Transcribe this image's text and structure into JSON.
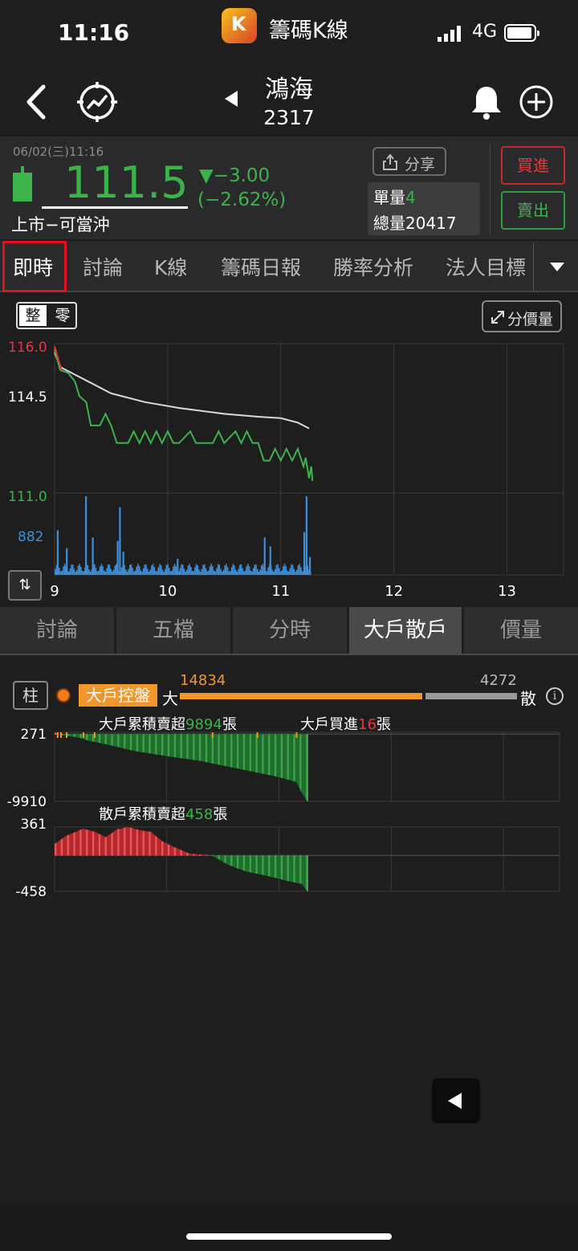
{
  "status_bar": {
    "time": "11:16",
    "app_name": "籌碼K線",
    "app_icon_letter": "K",
    "network": "4G"
  },
  "stock": {
    "name": "鴻海",
    "code": "2317"
  },
  "quote": {
    "datetime": "06/02(三)11:16",
    "price": "111.5",
    "change": "▼−3.00",
    "change_pct": "(−2.62%)",
    "market": "上市−可當沖",
    "share_label": "分享",
    "unit_vol_label": "單量",
    "unit_vol": "4",
    "total_vol_label": "總量",
    "total_vol": "20417",
    "buy_label": "買進",
    "sell_label": "賣出"
  },
  "tabs": [
    "即時",
    "討論",
    "K線",
    "籌碼日報",
    "勝率分析",
    "法人目標"
  ],
  "chart_controls": {
    "whole_label": "整",
    "odd_label": "零",
    "price_volume_label": "分價量"
  },
  "chart_data": [
    {
      "type": "line",
      "y_axis_labels": [
        "116.0",
        "114.5",
        "111.0"
      ],
      "volume_label": "882",
      "x": [
        "9",
        "10",
        "11",
        "12",
        "13"
      ],
      "ylim": [
        111.0,
        116.0
      ],
      "xlim": [
        9,
        13.5
      ],
      "series": [
        {
          "color": "#d9d9d9",
          "points": [
            [
              9.0,
              115.7
            ],
            [
              9.05,
              115.2
            ],
            [
              9.15,
              115.0
            ],
            [
              9.3,
              114.7
            ],
            [
              9.5,
              114.3
            ],
            [
              9.8,
              114.0
            ],
            [
              10.1,
              113.8
            ],
            [
              10.5,
              113.6
            ],
            [
              10.8,
              113.5
            ],
            [
              11.0,
              113.45
            ],
            [
              11.15,
              113.3
            ],
            [
              11.25,
              113.1
            ]
          ]
        },
        {
          "color": "#3cb34a",
          "points": [
            [
              9.0,
              115.8
            ],
            [
              9.05,
              115.1
            ],
            [
              9.12,
              115.0
            ],
            [
              9.18,
              114.7
            ],
            [
              9.22,
              114.2
            ],
            [
              9.28,
              114.0
            ],
            [
              9.32,
              113.2
            ],
            [
              9.4,
              113.2
            ],
            [
              9.45,
              113.6
            ],
            [
              9.5,
              113.2
            ],
            [
              9.55,
              112.6
            ],
            [
              9.65,
              112.6
            ],
            [
              9.7,
              113.0
            ],
            [
              9.75,
              112.6
            ],
            [
              9.8,
              113.0
            ],
            [
              9.85,
              112.6
            ],
            [
              9.9,
              113.0
            ],
            [
              9.95,
              112.6
            ],
            [
              10.0,
              113.0
            ],
            [
              10.05,
              112.6
            ],
            [
              10.1,
              112.6
            ],
            [
              10.2,
              113.0
            ],
            [
              10.25,
              112.6
            ],
            [
              10.4,
              112.6
            ],
            [
              10.45,
              113.0
            ],
            [
              10.5,
              112.6
            ],
            [
              10.6,
              113.0
            ],
            [
              10.65,
              112.6
            ],
            [
              10.7,
              113.0
            ],
            [
              10.75,
              112.6
            ],
            [
              10.8,
              112.6
            ],
            [
              10.85,
              112.0
            ],
            [
              10.9,
              112.0
            ],
            [
              10.95,
              112.4
            ],
            [
              11.0,
              112.0
            ],
            [
              11.05,
              112.4
            ],
            [
              11.1,
              112.0
            ],
            [
              11.15,
              112.4
            ],
            [
              11.2,
              111.8
            ],
            [
              11.22,
              112.1
            ],
            [
              11.25,
              111.4
            ],
            [
              11.27,
              111.8
            ],
            [
              11.28,
              111.3
            ]
          ]
        },
        {
          "color": "#e23b3b",
          "points": [
            [
              9.0,
              115.9
            ],
            [
              9.03,
              115.5
            ],
            [
              9.06,
              115.1
            ]
          ]
        }
      ],
      "volume": {
        "color": "#3e8fd8",
        "max": 882,
        "bars": [
          [
            9.02,
            500
          ],
          [
            9.1,
            300
          ],
          [
            9.27,
            882
          ],
          [
            9.33,
            420
          ],
          [
            9.55,
            380
          ],
          [
            9.57,
            760
          ],
          [
            9.6,
            260
          ],
          [
            10.08,
            180
          ],
          [
            10.85,
            420
          ],
          [
            10.9,
            320
          ],
          [
            11.2,
            480
          ],
          [
            11.22,
            882
          ],
          [
            11.25,
            200
          ]
        ]
      }
    },
    {
      "type": "area",
      "title": "大戶累積賣超",
      "value": "9894",
      "unit": "張",
      "sub_label": "大戶買進",
      "sub_value": "16",
      "y_axis_labels": [
        "271",
        "-9910"
      ],
      "ylim": [
        -9910,
        271
      ],
      "points": [
        [
          9.0,
          200
        ],
        [
          9.05,
          -100
        ],
        [
          9.2,
          -400
        ],
        [
          9.3,
          -900
        ],
        [
          9.5,
          -1600
        ],
        [
          9.7,
          -2400
        ],
        [
          10.0,
          -3200
        ],
        [
          10.3,
          -3900
        ],
        [
          10.5,
          -4600
        ],
        [
          10.8,
          -5600
        ],
        [
          11.0,
          -6300
        ],
        [
          11.15,
          -7000
        ],
        [
          11.2,
          -8600
        ],
        [
          11.25,
          -9910
        ]
      ]
    },
    {
      "type": "area",
      "title": "散戶累積賣超",
      "value": "458",
      "unit": "張",
      "y_axis_labels": [
        "361",
        "-458"
      ],
      "ylim": [
        -458,
        361
      ],
      "points": [
        [
          9.0,
          150
        ],
        [
          9.1,
          250
        ],
        [
          9.25,
          340
        ],
        [
          9.35,
          300
        ],
        [
          9.45,
          230
        ],
        [
          9.55,
          330
        ],
        [
          9.65,
          361
        ],
        [
          9.75,
          320
        ],
        [
          9.85,
          300
        ],
        [
          9.95,
          180
        ],
        [
          10.05,
          110
        ],
        [
          10.2,
          20
        ],
        [
          10.4,
          0
        ],
        [
          10.55,
          -120
        ],
        [
          10.7,
          -200
        ],
        [
          10.9,
          -260
        ],
        [
          11.1,
          -330
        ],
        [
          11.2,
          -360
        ],
        [
          11.25,
          -458
        ]
      ]
    }
  ],
  "sub_tabs": [
    "討論",
    "五檔",
    "分時",
    "大戶散戶",
    "價量"
  ],
  "big_small": {
    "col_label": "柱",
    "badge": "大戶控盤",
    "big_char": "大",
    "small_char": "散",
    "big_value": "14834",
    "small_value": "4272"
  },
  "colors": {
    "up": "#e23b3b",
    "down": "#3cb34a",
    "accent": "#f0962a",
    "volume": "#3e8fd8"
  }
}
